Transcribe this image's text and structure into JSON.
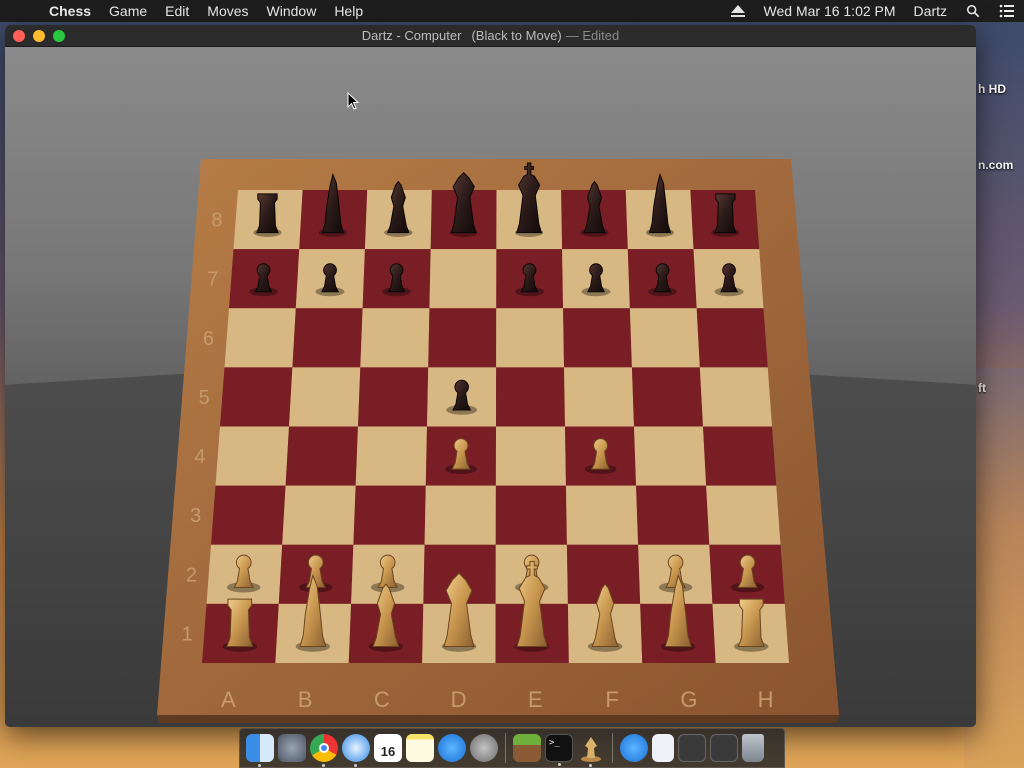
{
  "menubar": {
    "app_name": "Chess",
    "items": [
      "Game",
      "Edit",
      "Moves",
      "Window",
      "Help"
    ],
    "clock": "Wed Mar 16  1:02 PM",
    "user": "Dartz"
  },
  "desktop": {
    "fragments": [
      "h HD",
      "n.com",
      "ft"
    ]
  },
  "window": {
    "title": "Dartz - Computer",
    "status": "(Black to Move)",
    "edited": "— Edited"
  },
  "board": {
    "files": [
      "A",
      "B",
      "C",
      "D",
      "E",
      "F",
      "G",
      "H"
    ],
    "ranks": [
      "8",
      "7",
      "6",
      "5",
      "4",
      "3",
      "2",
      "1"
    ],
    "pieces": [
      {
        "sq": "a8",
        "type": "rook",
        "color": "black"
      },
      {
        "sq": "b8",
        "type": "knight",
        "color": "black"
      },
      {
        "sq": "c8",
        "type": "bishop",
        "color": "black"
      },
      {
        "sq": "d8",
        "type": "queen",
        "color": "black"
      },
      {
        "sq": "e8",
        "type": "king",
        "color": "black"
      },
      {
        "sq": "f8",
        "type": "bishop",
        "color": "black"
      },
      {
        "sq": "g8",
        "type": "knight",
        "color": "black"
      },
      {
        "sq": "h8",
        "type": "rook",
        "color": "black"
      },
      {
        "sq": "a7",
        "type": "pawn",
        "color": "black"
      },
      {
        "sq": "b7",
        "type": "pawn",
        "color": "black"
      },
      {
        "sq": "c7",
        "type": "pawn",
        "color": "black"
      },
      {
        "sq": "e7",
        "type": "pawn",
        "color": "black"
      },
      {
        "sq": "f7",
        "type": "pawn",
        "color": "black"
      },
      {
        "sq": "g7",
        "type": "pawn",
        "color": "black"
      },
      {
        "sq": "h7",
        "type": "pawn",
        "color": "black"
      },
      {
        "sq": "d5",
        "type": "pawn",
        "color": "black"
      },
      {
        "sq": "d4",
        "type": "pawn",
        "color": "white"
      },
      {
        "sq": "f4",
        "type": "pawn",
        "color": "white"
      },
      {
        "sq": "a2",
        "type": "pawn",
        "color": "white"
      },
      {
        "sq": "b2",
        "type": "pawn",
        "color": "white"
      },
      {
        "sq": "c2",
        "type": "pawn",
        "color": "white"
      },
      {
        "sq": "e2",
        "type": "pawn",
        "color": "white"
      },
      {
        "sq": "g2",
        "type": "pawn",
        "color": "white"
      },
      {
        "sq": "h2",
        "type": "pawn",
        "color": "white"
      },
      {
        "sq": "a1",
        "type": "rook",
        "color": "white"
      },
      {
        "sq": "b1",
        "type": "knight",
        "color": "white"
      },
      {
        "sq": "c1",
        "type": "bishop",
        "color": "white"
      },
      {
        "sq": "d1",
        "type": "queen",
        "color": "white"
      },
      {
        "sq": "e1",
        "type": "king",
        "color": "white"
      },
      {
        "sq": "f1",
        "type": "bishop",
        "color": "white"
      },
      {
        "sq": "g1",
        "type": "knight",
        "color": "white"
      },
      {
        "sq": "h1",
        "type": "rook",
        "color": "white"
      }
    ]
  },
  "dock": {
    "apps": [
      "finder-icon",
      "launchpad-icon",
      "chrome-icon",
      "safari-icon",
      "calendar-icon",
      "notes-icon",
      "app-store-icon",
      "system-preferences-icon",
      "minecraft-icon",
      "terminal-icon",
      "chess-icon",
      "app-store-downloads-icon",
      "document-icon",
      "screenshot-icon-1",
      "screenshot-icon-2",
      "trash-icon"
    ],
    "calendar_day": "16"
  },
  "colors": {
    "light_square": "#d8b882",
    "dark_square": "#7a1e26",
    "frame": "#a0693a",
    "black_piece": "#2a1a18",
    "white_piece": "#c8964e"
  }
}
